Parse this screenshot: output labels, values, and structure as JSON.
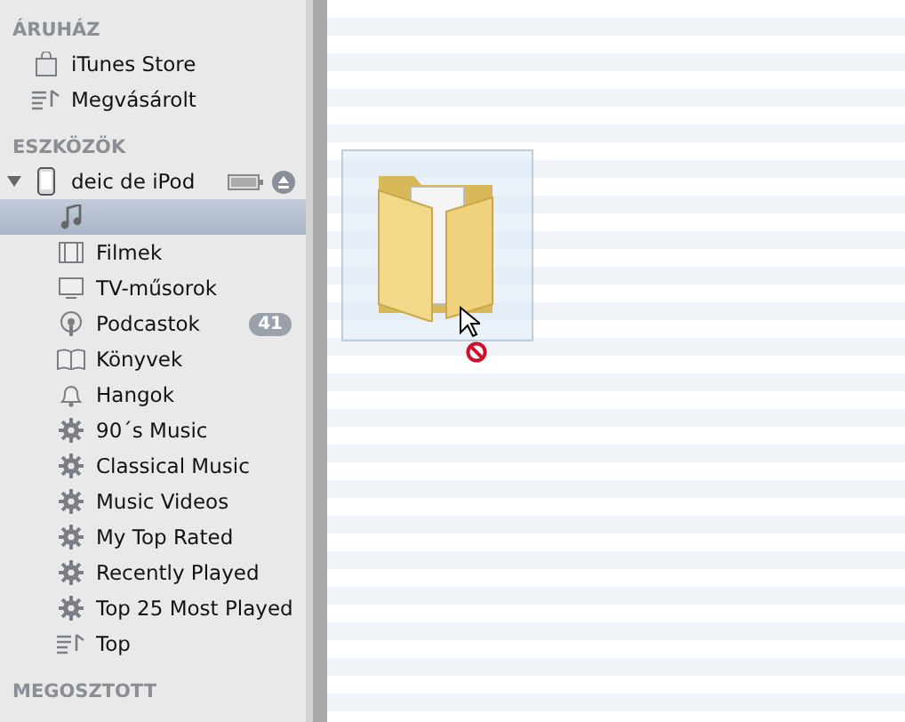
{
  "sidebar": {
    "sections": [
      {
        "title": "ÁRUHÁZ",
        "items": [
          {
            "kind": "store",
            "label": "iTunes Store",
            "selected": false
          },
          {
            "kind": "playlist",
            "label": "Megvásárolt",
            "selected": false
          }
        ]
      },
      {
        "title": "ESZKÖZÖK",
        "items": [
          {
            "kind": "device",
            "label": "deic de iPod",
            "selected": false,
            "expanded": true
          },
          {
            "kind": "music",
            "selected": true,
            "child": true
          },
          {
            "kind": "movies",
            "label": "Filmek",
            "selected": false,
            "child": true
          },
          {
            "kind": "tv",
            "label": "TV-műsorok",
            "selected": false,
            "child": true
          },
          {
            "kind": "podcasts",
            "label": "Podcastok",
            "selected": false,
            "child": true,
            "badge": "41"
          },
          {
            "kind": "books",
            "label": "Könyvek",
            "selected": false,
            "child": true
          },
          {
            "kind": "tones",
            "label": "Hangok",
            "selected": false,
            "child": true
          },
          {
            "kind": "smart",
            "label": "90´s Music",
            "selected": false,
            "child": true
          },
          {
            "kind": "smart",
            "label": "Classical Music",
            "selected": false,
            "child": true
          },
          {
            "kind": "smart",
            "label": "Music Videos",
            "selected": false,
            "child": true
          },
          {
            "kind": "smart",
            "label": "My Top Rated",
            "selected": false,
            "child": true
          },
          {
            "kind": "smart",
            "label": "Recently Played",
            "selected": false,
            "child": true
          },
          {
            "kind": "smart",
            "label": "Top 25 Most Played",
            "selected": false,
            "child": true
          },
          {
            "kind": "playlist",
            "label": "Top",
            "selected": false,
            "child": true
          }
        ]
      },
      {
        "title": "MEGOSZTOTT"
      }
    ]
  },
  "drag": {
    "kind": "folder",
    "drop_allowed": false
  }
}
